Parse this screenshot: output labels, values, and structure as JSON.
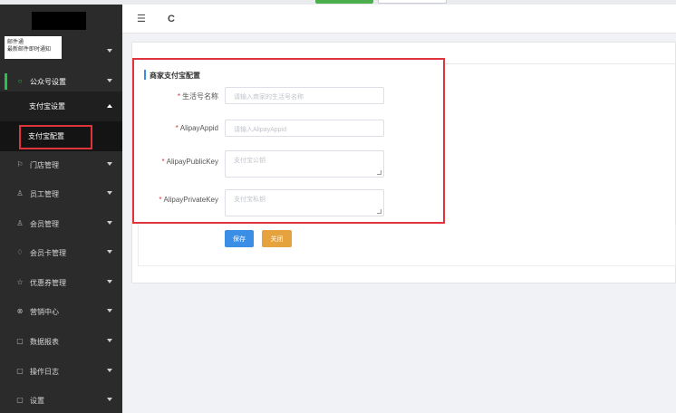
{
  "notice": {
    "line1": "邮件通",
    "line2": "最新邮件即时通知"
  },
  "sidebar": {
    "items": [
      {
        "label": "公众号设置",
        "icon": "circle-icon"
      },
      {
        "label": "门店管理",
        "icon": "flag-icon"
      },
      {
        "label": "员工管理",
        "icon": "user-icon"
      },
      {
        "label": "会员管理",
        "icon": "user-icon"
      },
      {
        "label": "会员卡管理",
        "icon": "card-icon"
      },
      {
        "label": "优惠券管理",
        "icon": "star-icon"
      },
      {
        "label": "营销中心",
        "icon": "gift-icon"
      },
      {
        "label": "数据报表",
        "icon": "chart-icon"
      },
      {
        "label": "操作日志",
        "icon": "log-icon"
      },
      {
        "label": "设置",
        "icon": "settings-icon"
      }
    ],
    "sub_parent": "支付宝设置",
    "sub_item": "支付宝配置"
  },
  "header": {
    "menu_icon": "☰",
    "refresh_icon": "C"
  },
  "form": {
    "title": "商家支付宝配置",
    "fields": [
      {
        "label": "生活号名称",
        "placeholder": "请输入商家的生活号名称"
      },
      {
        "label": "AlipayAppid",
        "placeholder": "请输入AlipayAppid"
      },
      {
        "label": "AlipayPublicKey",
        "placeholder": "支付宝公钥"
      },
      {
        "label": "AlipayPrivateKey",
        "placeholder": "支付宝私钥"
      }
    ],
    "required_mark": "*",
    "save_label": "保存",
    "close_label": "关闭"
  },
  "colors": {
    "accent": "#3a8ee6",
    "warning": "#e6a23c",
    "highlight": "#e0343c",
    "active": "#27c24c"
  }
}
